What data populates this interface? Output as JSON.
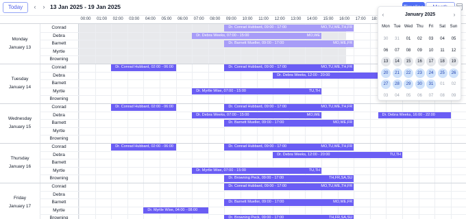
{
  "toolbar": {
    "today_label": "Today",
    "prev_icon": "chevron-left-icon",
    "next_icon": "chevron-right-icon",
    "range": "13 Jan 2025 - 19 Jan 2025",
    "timeline_label": "Timeline",
    "month_label": "Month",
    "calendar_icon": "calendar-icon"
  },
  "hours": [
    "00:00",
    "01:00",
    "02:00",
    "03:00",
    "04:00",
    "05:00",
    "06:00",
    "07:00",
    "08:00",
    "09:00",
    "10:00",
    "11:00",
    "12:00",
    "13:00",
    "14:00",
    "15:00",
    "16:00",
    "17:00",
    "18:00"
  ],
  "colors": {
    "event": "#6a5df4",
    "event_light": "#a79cf8",
    "accent": "#4f6ef5",
    "highlight": "#cfe2fb"
  },
  "days": [
    {
      "name": "Monday",
      "date": "January 13",
      "resources": [
        "Conrad",
        "Debra",
        "Barnett",
        "Myrtle",
        "Browning"
      ]
    },
    {
      "name": "Tuesday",
      "date": "January 14",
      "resources": [
        "Conrad",
        "Debra",
        "Barnett",
        "Myrtle",
        "Browning"
      ]
    },
    {
      "name": "Wednesday",
      "date": "January 15",
      "resources": [
        "Conrad",
        "Debra",
        "Barnett",
        "Myrtle",
        "Browning"
      ]
    },
    {
      "name": "Thursday",
      "date": "January 16",
      "resources": [
        "Conrad",
        "Debra",
        "Barnett",
        "Myrtle",
        "Browning"
      ]
    },
    {
      "name": "Friday",
      "date": "January 17",
      "resources": [
        "Conrad",
        "Debra",
        "Barnett",
        "Myrtle",
        "Browning"
      ]
    }
  ],
  "events": [
    {
      "title": "Dr. Conrad Hubbard, 09:00 - 17:00",
      "days": "MO,TU,WE,TH,FR",
      "day": 0,
      "row": 0,
      "start": 9,
      "end": 17,
      "light": true
    },
    {
      "title": "Dr. Debra Weeks, 07:00 - 15:00",
      "days": "MO,WE",
      "day": 0,
      "row": 1,
      "start": 7,
      "end": 15,
      "light": true
    },
    {
      "title": "Dr. Barnett Mueller, 09:00 - 17:00",
      "days": "MO,WE,FR",
      "day": 0,
      "row": 2,
      "start": 9,
      "end": 17,
      "light": true
    },
    {
      "title": "Dr. Conrad Hubbard, 02:00 - 06:00",
      "days": "",
      "day": 1,
      "row": 0,
      "start": 2,
      "end": 6,
      "light": false
    },
    {
      "title": "Dr. Conrad Hubbard, 09:00 - 17:00",
      "days": "MO,TU,WE,TH,FR",
      "day": 1,
      "row": 0,
      "start": 9,
      "end": 17,
      "light": false
    },
    {
      "title": "Dr. Debra Weeks, 12:00 - 20:00",
      "days": "TU,TH",
      "day": 1,
      "row": 1,
      "start": 12,
      "end": 20,
      "light": false
    },
    {
      "title": "Dr. Myrtle Wise, 07:00 - 15:00",
      "days": "TU,TH",
      "day": 1,
      "row": 3,
      "start": 7,
      "end": 15,
      "light": false
    },
    {
      "title": "Dr. Conrad Hubbard, 02:00 - 06:00",
      "days": "",
      "day": 2,
      "row": 0,
      "start": 2,
      "end": 6,
      "light": false
    },
    {
      "title": "Dr. Conrad Hubbard, 09:00 - 17:00",
      "days": "MO,TU,WE,TH,FR",
      "day": 2,
      "row": 0,
      "start": 9,
      "end": 17,
      "light": false
    },
    {
      "title": "Dr. Debra Weeks, 07:00 - 15:00",
      "days": "MO,WE",
      "day": 2,
      "row": 1,
      "start": 7,
      "end": 15,
      "light": false
    },
    {
      "title": "Dr. Debra Weeks, 16:00 - 22:00",
      "days": "",
      "day": 2,
      "row": 1,
      "start": 18.5,
      "end": 23,
      "light": false
    },
    {
      "title": "Dr. Barnett Mueller, 09:00 - 17:00",
      "days": "MO,WE,FR",
      "day": 2,
      "row": 2,
      "start": 9,
      "end": 17,
      "light": false
    },
    {
      "title": "Dr. Conrad Hubbard, 02:00 - 06:00",
      "days": "",
      "day": 3,
      "row": 0,
      "start": 2,
      "end": 6,
      "light": false
    },
    {
      "title": "Dr. Conrad Hubbard, 09:00 - 17:00",
      "days": "MO,TU,WE,TH,FR",
      "day": 3,
      "row": 0,
      "start": 9,
      "end": 17,
      "light": false
    },
    {
      "title": "Dr. Debra Weeks, 12:00 - 20:00",
      "days": "TU,TH",
      "day": 3,
      "row": 1,
      "start": 12,
      "end": 20,
      "light": false
    },
    {
      "title": "Dr. Myrtle Wise, 07:00 - 15:00",
      "days": "TU,TH",
      "day": 3,
      "row": 3,
      "start": 7,
      "end": 15,
      "light": false
    },
    {
      "title": "Dr. Browning Peck, 09:00 - 17:00",
      "days": "TH,FR,SA,SU",
      "day": 3,
      "row": 4,
      "start": 9,
      "end": 17,
      "light": false
    },
    {
      "title": "Dr. Conrad Hubbard, 09:00 - 17:00",
      "days": "MO,TU,WE,TH,FR",
      "day": 4,
      "row": 0,
      "start": 9,
      "end": 17,
      "light": false
    },
    {
      "title": "Dr. Barnett Mueller, 09:00 - 17:00",
      "days": "MO,WE,FR",
      "day": 4,
      "row": 2,
      "start": 9,
      "end": 17,
      "light": false
    },
    {
      "title": "Dr. Myrtle Wise, 04:00 - 08:00",
      "days": "",
      "day": 4,
      "row": 3,
      "start": 4,
      "end": 8,
      "light": false
    },
    {
      "title": "Dr. Browning Peck, 09:00 - 17:00",
      "days": "TH,FR,SA,SU",
      "day": 4,
      "row": 4,
      "start": 9,
      "end": 17,
      "light": false
    }
  ],
  "datepicker": {
    "title": "January 2025",
    "prev_icon": "chevron-left-icon",
    "next_icon": "chevron-right-icon",
    "weekdays": [
      "Mon",
      "Tue",
      "Wed",
      "Thu",
      "Fri",
      "Sat",
      "Sun"
    ],
    "weeks": [
      [
        {
          "d": "30",
          "s": "muted"
        },
        {
          "d": "31",
          "s": "muted"
        },
        {
          "d": "01",
          "s": ""
        },
        {
          "d": "02",
          "s": ""
        },
        {
          "d": "03",
          "s": ""
        },
        {
          "d": "04",
          "s": ""
        },
        {
          "d": "05",
          "s": ""
        }
      ],
      [
        {
          "d": "06",
          "s": ""
        },
        {
          "d": "07",
          "s": ""
        },
        {
          "d": "08",
          "s": ""
        },
        {
          "d": "09",
          "s": ""
        },
        {
          "d": "10",
          "s": ""
        },
        {
          "d": "11",
          "s": ""
        },
        {
          "d": "12",
          "s": ""
        }
      ],
      [
        {
          "d": "13",
          "s": "grey"
        },
        {
          "d": "14",
          "s": "grey"
        },
        {
          "d": "15",
          "s": "grey"
        },
        {
          "d": "16",
          "s": "grey"
        },
        {
          "d": "17",
          "s": "grey"
        },
        {
          "d": "18",
          "s": "grey"
        },
        {
          "d": "19",
          "s": "grey"
        }
      ],
      [
        {
          "d": "20",
          "s": "blue"
        },
        {
          "d": "21",
          "s": "blue"
        },
        {
          "d": "22",
          "s": "blue"
        },
        {
          "d": "23",
          "s": "blue"
        },
        {
          "d": "24",
          "s": "blue"
        },
        {
          "d": "25",
          "s": "blue"
        },
        {
          "d": "26",
          "s": "blue"
        }
      ],
      [
        {
          "d": "27",
          "s": "blue"
        },
        {
          "d": "28",
          "s": "blue"
        },
        {
          "d": "29",
          "s": "blue"
        },
        {
          "d": "30",
          "s": "blue"
        },
        {
          "d": "31",
          "s": "blue"
        },
        {
          "d": "01",
          "s": "muted"
        },
        {
          "d": "02",
          "s": "muted"
        }
      ],
      [
        {
          "d": "03",
          "s": "muted"
        },
        {
          "d": "04",
          "s": "muted"
        },
        {
          "d": "05",
          "s": "muted"
        },
        {
          "d": "06",
          "s": "muted"
        },
        {
          "d": "07",
          "s": "muted"
        },
        {
          "d": "08",
          "s": "muted"
        },
        {
          "d": "09",
          "s": "muted"
        }
      ]
    ]
  }
}
